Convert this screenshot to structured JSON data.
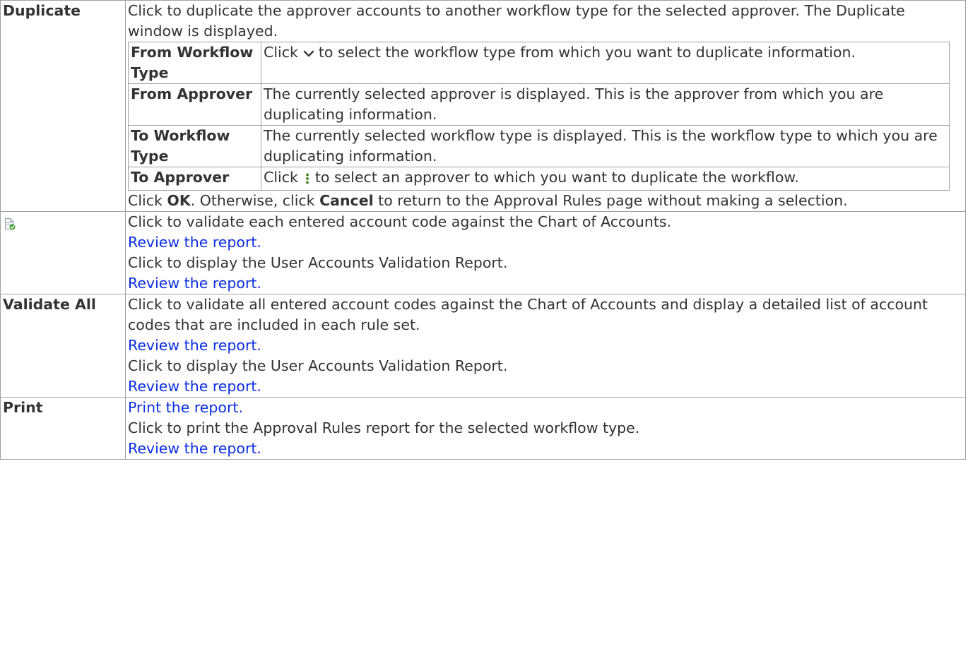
{
  "duplicate": {
    "term": "Duplicate",
    "desc": "Click to duplicate the approver accounts to another workflow type for the selected approver. The Duplicate window is displayed.",
    "rows": [
      {
        "term": "From Workflow Type",
        "pre": "Click",
        "icon": "chevron-down-icon",
        "post": "to select the workflow type from which you want to duplicate information."
      },
      {
        "term": "From Approver",
        "text": "The currently selected approver is displayed. This is the approver from which you are duplicating information."
      },
      {
        "term": "To Workflow Type",
        "text": "The currently selected workflow type is displayed. This is the workflow type to which you are duplicating information."
      },
      {
        "term": "To Approver",
        "pre": "Click",
        "icon": "kebab-menu-icon",
        "post": "to select an approver to which you want to duplicate the workflow."
      }
    ],
    "footer": {
      "click": "Click",
      "ok": "OK",
      "otherwise": ". Otherwise, click",
      "cancel": "Cancel",
      "rest": "to return to the Approval Rules page without making a selection."
    }
  },
  "validate_icon_row": {
    "icon": "validate-report-icon",
    "line1": "Click to validate each entered account code against the Chart of Accounts.",
    "link1": "Review the report.",
    "line2": "Click to display the User Accounts Validation Report.",
    "link2": "Review the report."
  },
  "validate_all": {
    "term": "Validate All",
    "line1": "Click to validate all entered account codes against the Chart of Accounts and display a detailed list of account codes that are included in each rule set.",
    "link1": "Review the report.",
    "line2": "Click to display the User Accounts Validation Report.",
    "link2": "Review the report."
  },
  "print": {
    "term": "Print",
    "link1": "Print the report.",
    "line": "Click to print the Approval Rules report for the selected workflow type.",
    "link2": "Review the report."
  },
  "colors": {
    "link": "#0b2ee0",
    "text": "#333333",
    "border": "#a0a0a0"
  }
}
